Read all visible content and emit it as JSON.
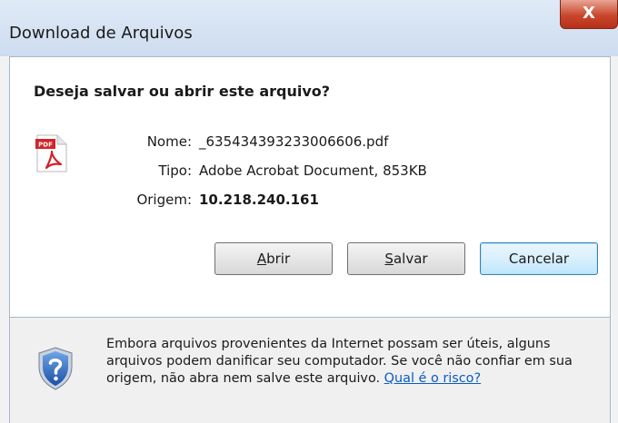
{
  "window": {
    "title": "Download de Arquivos",
    "close_glyph": "X"
  },
  "dialog": {
    "question": "Deseja salvar ou abrir este arquivo?",
    "file_icon": "pdf-file-icon",
    "file_icon_badge": "PDF",
    "fields": {
      "name_label": "Nome:",
      "name_value": "_635434393233006606.pdf",
      "type_label": "Tipo:",
      "type_value": "Adobe Acrobat Document, 853KB",
      "origin_label": "Origem:",
      "origin_value": "10.218.240.161"
    },
    "buttons": {
      "open_accel": "A",
      "open_rest": "brir",
      "save_accel": "S",
      "save_rest": "alvar",
      "cancel_label": "Cancelar"
    }
  },
  "footer": {
    "icon": "shield-question-icon",
    "warning_text": "Embora arquivos provenientes da Internet possam ser úteis, alguns arquivos podem danificar seu computador. Se você não confiar em sua origem, não abra nem salve este arquivo.",
    "risk_link": "Qual é o risco?"
  },
  "colors": {
    "link": "#0a5bc4",
    "close_button": "#c9472d",
    "pdf_red": "#d2232a"
  }
}
